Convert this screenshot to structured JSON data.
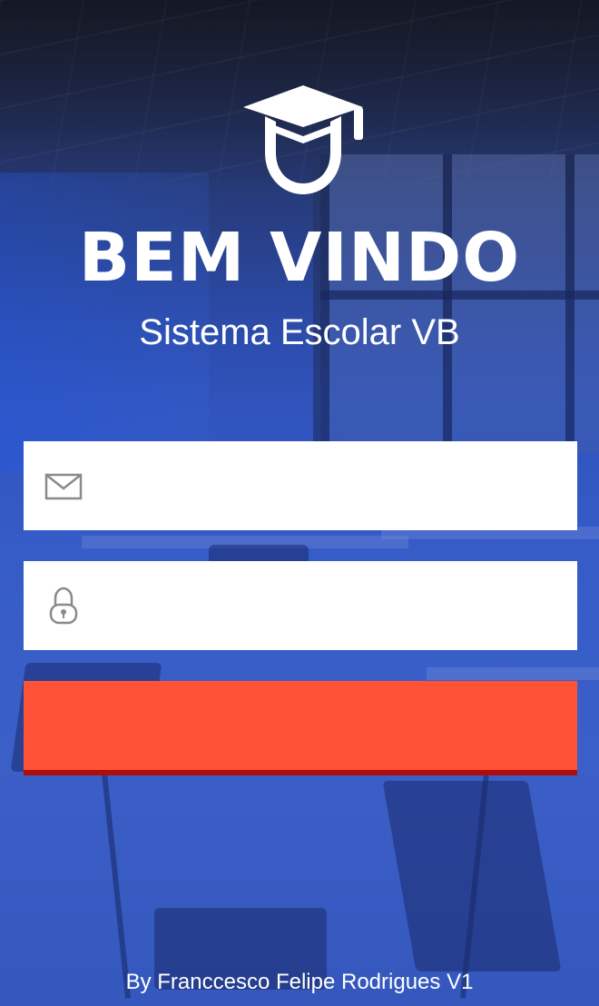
{
  "header": {
    "logo_icon": "graduation-cap-student-icon",
    "title": "BEM VINDO",
    "subtitle": "Sistema Escolar VB"
  },
  "form": {
    "email": {
      "icon": "envelope-icon",
      "value": "",
      "placeholder": ""
    },
    "password": {
      "icon": "padlock-icon",
      "value": "",
      "placeholder": ""
    },
    "submit": {
      "label": "",
      "color": "#ff5337",
      "shadow_color": "#b10c0c"
    }
  },
  "footer": {
    "credit": "By Franccesco Felipe Rodrigues V1"
  },
  "colors": {
    "background_primary": "#3a5fc8",
    "field_background": "#ffffff",
    "icon_color": "#8a8a8a"
  }
}
